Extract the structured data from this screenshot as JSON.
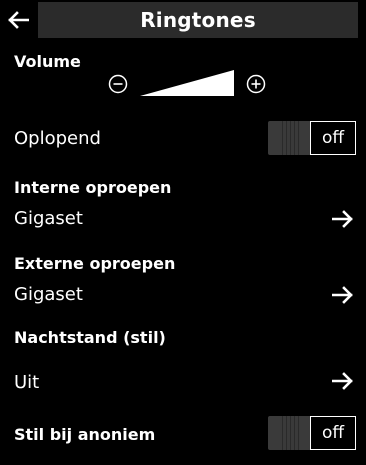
{
  "header": {
    "title": "Ringtones"
  },
  "volume": {
    "label": "Volume"
  },
  "oplopend": {
    "label": "Oplopend",
    "state": "off"
  },
  "interne": {
    "heading": "Interne oproepen",
    "value": "Gigaset"
  },
  "externe": {
    "heading": "Externe oproepen",
    "value": "Gigaset"
  },
  "nachtstand": {
    "heading": "Nachtstand (stil)",
    "value": "Uit"
  },
  "anoniem": {
    "label": "Stil bij anoniem",
    "state": "off"
  },
  "icons": {
    "back": "arrow-left-icon",
    "minus": "circle-minus-icon",
    "plus": "circle-plus-icon",
    "forward": "arrow-right-icon"
  },
  "colors": {
    "background": "#000000",
    "title_bar": "#2b2b2b",
    "text": "#ffffff",
    "toggle_knob": "#3a3a3a"
  }
}
